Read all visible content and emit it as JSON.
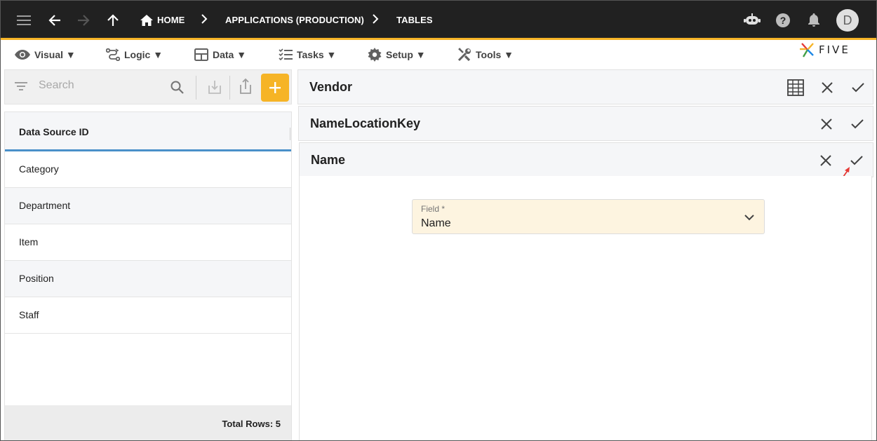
{
  "topbar": {
    "breadcrumbs": [
      "HOME",
      "APPLICATIONS (PRODUCTION)",
      "TABLES"
    ],
    "avatar_letter": "D",
    "icons": [
      "menu-icon",
      "back-arrow-icon",
      "forward-arrow-icon",
      "up-arrow-icon",
      "home-icon",
      "chat-bot-icon",
      "help-icon",
      "bell-icon"
    ]
  },
  "menubar": {
    "items": [
      {
        "label": "Visual ▼",
        "icon": "eye-icon"
      },
      {
        "label": "Logic ▼",
        "icon": "logic-icon"
      },
      {
        "label": "Data ▼",
        "icon": "table-icon"
      },
      {
        "label": "Tasks ▼",
        "icon": "tasks-icon"
      },
      {
        "label": "Setup ▼",
        "icon": "gear-icon"
      },
      {
        "label": "Tools ▼",
        "icon": "tools-icon"
      }
    ],
    "logo_text": "FIVE"
  },
  "left": {
    "search_placeholder": "Search",
    "column_header": "Data Source ID",
    "rows": [
      "Category",
      "Department",
      "Item",
      "Position",
      "Staff"
    ],
    "footer": "Total Rows: 5"
  },
  "right": {
    "cards": [
      "Vendor",
      "NameLocationKey",
      "Name"
    ],
    "field": {
      "label": "Field *",
      "value": "Name"
    }
  },
  "colors": {
    "accent": "#f6b426",
    "topbar": "#212121",
    "header_underline": "#4a90c9",
    "field_bg": "#fdf4e0",
    "annotation_arrow": "#e53935"
  }
}
